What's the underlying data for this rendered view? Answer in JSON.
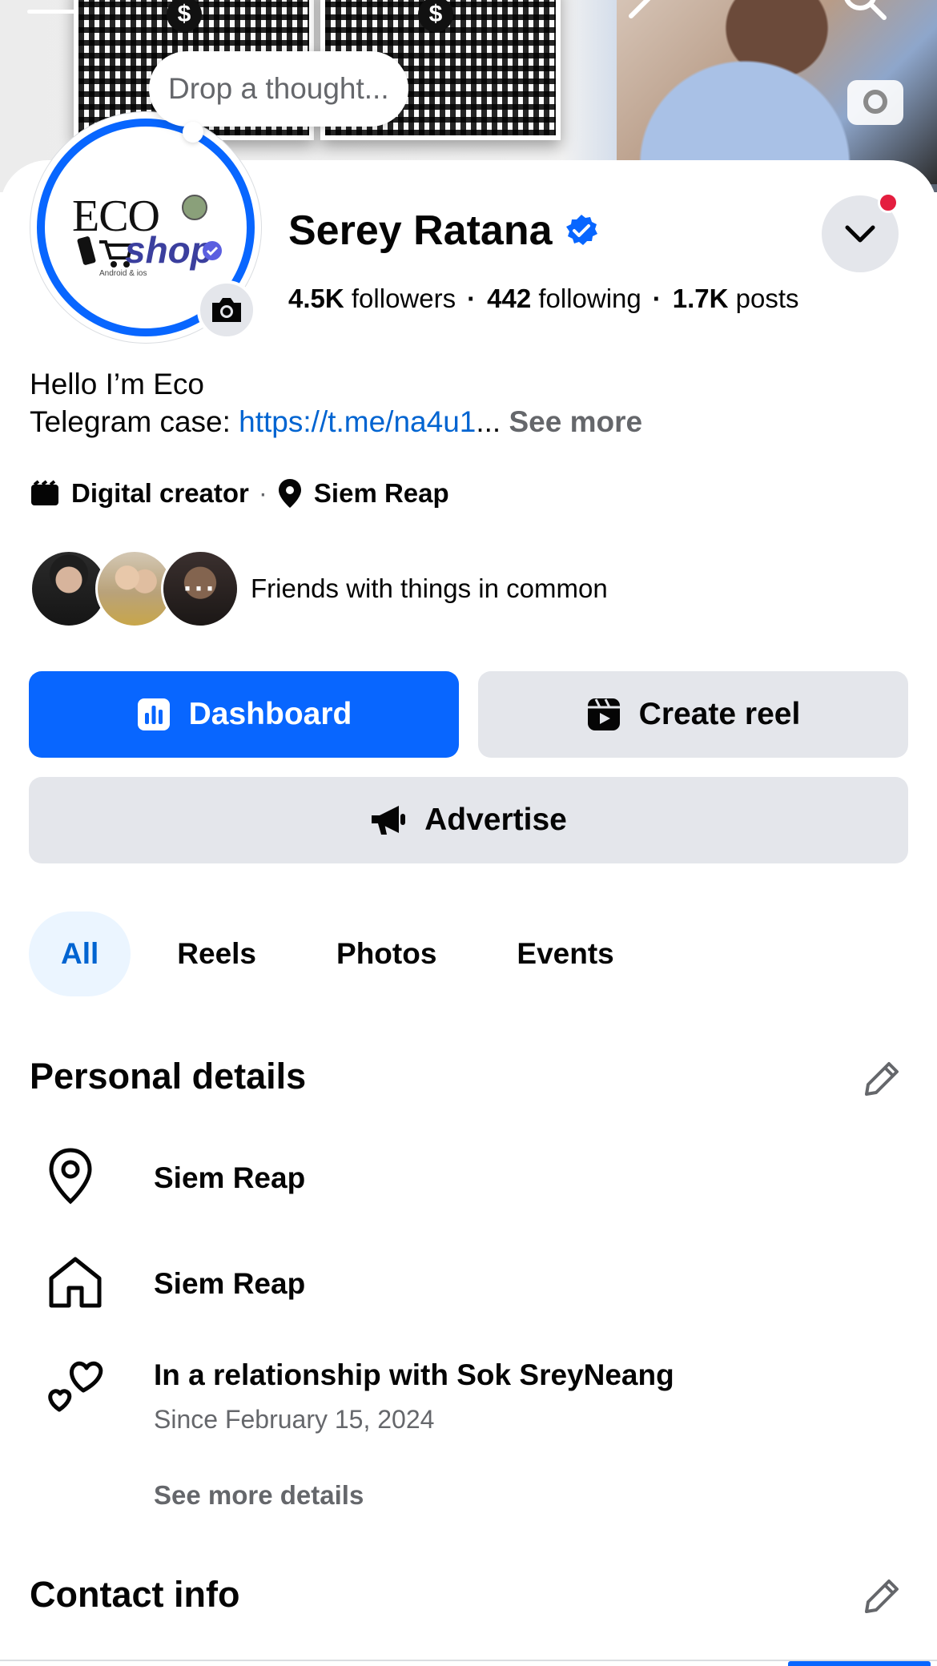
{
  "cover": {
    "qr_coin_symbol_1": "$",
    "qr_coin_symbol_2": "$"
  },
  "thought_bubble": {
    "placeholder": "Drop a thought..."
  },
  "avatar": {
    "logo_line_1": "ECO",
    "logo_line_2": "shop",
    "logo_line_3": "Android & ios"
  },
  "profile": {
    "name": "Serey Ratana",
    "verified": true,
    "followers_count": "4.5K",
    "followers_label": "followers",
    "following_count": "442",
    "following_label": "following",
    "posts_count": "1.7K",
    "posts_label": "posts",
    "separator": "·"
  },
  "bio": {
    "line1": "Hello I’m Eco",
    "line2_prefix": "Telegram case: ",
    "link_text": "https://t.me/na4u1",
    "ellipsis": "...",
    "see_more": "See more"
  },
  "meta": {
    "category": "Digital creator",
    "separator": "·",
    "location": "Siem Reap"
  },
  "friends": {
    "overflow": "···",
    "label": "Friends with things in common"
  },
  "actions": {
    "dashboard": "Dashboard",
    "create_reel": "Create reel",
    "advertise": "Advertise"
  },
  "tabs": [
    {
      "label": "All",
      "active": true
    },
    {
      "label": "Reels",
      "active": false
    },
    {
      "label": "Photos",
      "active": false
    },
    {
      "label": "Events",
      "active": false
    }
  ],
  "personal_details": {
    "title": "Personal details",
    "items": [
      {
        "icon": "location-pin-icon",
        "text": "Siem Reap"
      },
      {
        "icon": "home-icon",
        "text": "Siem Reap"
      },
      {
        "icon": "hearts-icon",
        "text": "In a relationship with Sok SreyNeang",
        "sub": "Since February 15, 2024"
      }
    ],
    "see_more": "See more details"
  },
  "contact_info": {
    "title": "Contact info"
  },
  "colors": {
    "brand_blue": "#0866ff",
    "link_blue": "#0064d1",
    "button_gray": "#e4e6eb",
    "secondary_text": "#65676b",
    "notification_red": "#e41e3f"
  }
}
